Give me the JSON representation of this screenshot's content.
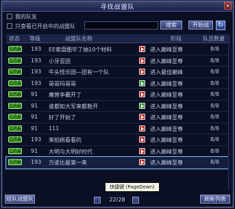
{
  "window": {
    "title": "寻找战盟队",
    "close_label": "×"
  },
  "filters": {
    "friends_label": "我的队友",
    "only_show_label": "只查看已开启中的战盟队",
    "search_placeholder": "",
    "search_button": "搜索",
    "create_button": "开始战",
    "refresh_icon": "refresh-icon"
  },
  "columns": [
    "状态",
    "等级",
    "战盟队名称",
    "阶段",
    "队员数量"
  ],
  "rows": [
    {
      "status": "已开启",
      "level": "193",
      "name": "EE索盘酷毕了抽10个材料",
      "mode": "red",
      "stage": "进入巅峰至尊",
      "count": "8/8"
    },
    {
      "status": "已开启",
      "level": "193",
      "name": "小牙亚团",
      "mode": "red",
      "stage": "进入巅峰至尊",
      "count": "8/8"
    },
    {
      "status": "已开启",
      "level": "193",
      "name": "牛头怪乐园—团有一个队",
      "mode": "red",
      "stage": "进入最佳巅峰",
      "count": "8/8"
    },
    {
      "status": "已开启",
      "level": "193",
      "name": "哥哥玛哥哥",
      "mode": "green",
      "stage": "进入巅峰至尊",
      "count": "8/8"
    },
    {
      "status": "已开启",
      "level": "91",
      "name": "魔兽争霸开了",
      "mode": "red",
      "stage": "进入巅峰至尊",
      "count": "8/8"
    },
    {
      "status": "已开启",
      "level": "91",
      "name": "谁都知大军来都救开",
      "mode": "green",
      "stage": "进入巅峰至尊",
      "count": "8/8"
    },
    {
      "status": "已开启",
      "level": "91",
      "name": "好了开始了",
      "mode": "red",
      "stage": "进入巅峰至尊",
      "count": "8/8"
    },
    {
      "status": "已开启",
      "level": "91",
      "name": "111",
      "mode": "red",
      "stage": "进入巅峰至尊",
      "count": "8/8"
    },
    {
      "status": "已开启",
      "level": "193",
      "name": "来拍刷看看的",
      "mode": "red",
      "stage": "进入巅峰至尊",
      "count": "8/8"
    },
    {
      "status": "已开启",
      "level": "91",
      "name": "大明与大明好时代",
      "mode": "red",
      "stage": "进入巅峰至尊",
      "count": "8/8"
    },
    {
      "status": "已开启",
      "level": "193",
      "name": "万谁比最第一来",
      "mode": "red",
      "stage": "进入巅峰至尊",
      "count": "8/8"
    }
  ],
  "tooltip": "快捷键 (PageDown)",
  "pager": {
    "text": "22/28"
  },
  "footer": {
    "left_button": "组队战盟队",
    "right_button": "刷新列表"
  }
}
